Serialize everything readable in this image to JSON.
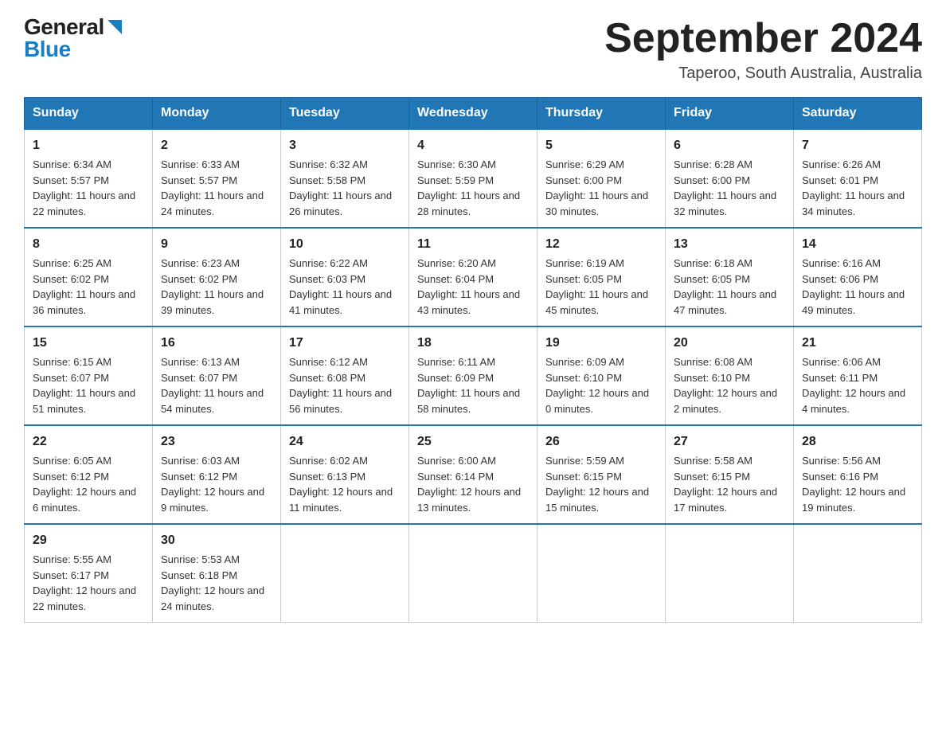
{
  "logo": {
    "general": "General",
    "blue": "Blue"
  },
  "header": {
    "month_year": "September 2024",
    "location": "Taperoo, South Australia, Australia"
  },
  "days_of_week": [
    "Sunday",
    "Monday",
    "Tuesday",
    "Wednesday",
    "Thursday",
    "Friday",
    "Saturday"
  ],
  "weeks": [
    [
      {
        "day": "1",
        "sunrise": "6:34 AM",
        "sunset": "5:57 PM",
        "daylight": "11 hours and 22 minutes."
      },
      {
        "day": "2",
        "sunrise": "6:33 AM",
        "sunset": "5:57 PM",
        "daylight": "11 hours and 24 minutes."
      },
      {
        "day": "3",
        "sunrise": "6:32 AM",
        "sunset": "5:58 PM",
        "daylight": "11 hours and 26 minutes."
      },
      {
        "day": "4",
        "sunrise": "6:30 AM",
        "sunset": "5:59 PM",
        "daylight": "11 hours and 28 minutes."
      },
      {
        "day": "5",
        "sunrise": "6:29 AM",
        "sunset": "6:00 PM",
        "daylight": "11 hours and 30 minutes."
      },
      {
        "day": "6",
        "sunrise": "6:28 AM",
        "sunset": "6:00 PM",
        "daylight": "11 hours and 32 minutes."
      },
      {
        "day": "7",
        "sunrise": "6:26 AM",
        "sunset": "6:01 PM",
        "daylight": "11 hours and 34 minutes."
      }
    ],
    [
      {
        "day": "8",
        "sunrise": "6:25 AM",
        "sunset": "6:02 PM",
        "daylight": "11 hours and 36 minutes."
      },
      {
        "day": "9",
        "sunrise": "6:23 AM",
        "sunset": "6:02 PM",
        "daylight": "11 hours and 39 minutes."
      },
      {
        "day": "10",
        "sunrise": "6:22 AM",
        "sunset": "6:03 PM",
        "daylight": "11 hours and 41 minutes."
      },
      {
        "day": "11",
        "sunrise": "6:20 AM",
        "sunset": "6:04 PM",
        "daylight": "11 hours and 43 minutes."
      },
      {
        "day": "12",
        "sunrise": "6:19 AM",
        "sunset": "6:05 PM",
        "daylight": "11 hours and 45 minutes."
      },
      {
        "day": "13",
        "sunrise": "6:18 AM",
        "sunset": "6:05 PM",
        "daylight": "11 hours and 47 minutes."
      },
      {
        "day": "14",
        "sunrise": "6:16 AM",
        "sunset": "6:06 PM",
        "daylight": "11 hours and 49 minutes."
      }
    ],
    [
      {
        "day": "15",
        "sunrise": "6:15 AM",
        "sunset": "6:07 PM",
        "daylight": "11 hours and 51 minutes."
      },
      {
        "day": "16",
        "sunrise": "6:13 AM",
        "sunset": "6:07 PM",
        "daylight": "11 hours and 54 minutes."
      },
      {
        "day": "17",
        "sunrise": "6:12 AM",
        "sunset": "6:08 PM",
        "daylight": "11 hours and 56 minutes."
      },
      {
        "day": "18",
        "sunrise": "6:11 AM",
        "sunset": "6:09 PM",
        "daylight": "11 hours and 58 minutes."
      },
      {
        "day": "19",
        "sunrise": "6:09 AM",
        "sunset": "6:10 PM",
        "daylight": "12 hours and 0 minutes."
      },
      {
        "day": "20",
        "sunrise": "6:08 AM",
        "sunset": "6:10 PM",
        "daylight": "12 hours and 2 minutes."
      },
      {
        "day": "21",
        "sunrise": "6:06 AM",
        "sunset": "6:11 PM",
        "daylight": "12 hours and 4 minutes."
      }
    ],
    [
      {
        "day": "22",
        "sunrise": "6:05 AM",
        "sunset": "6:12 PM",
        "daylight": "12 hours and 6 minutes."
      },
      {
        "day": "23",
        "sunrise": "6:03 AM",
        "sunset": "6:12 PM",
        "daylight": "12 hours and 9 minutes."
      },
      {
        "day": "24",
        "sunrise": "6:02 AM",
        "sunset": "6:13 PM",
        "daylight": "12 hours and 11 minutes."
      },
      {
        "day": "25",
        "sunrise": "6:00 AM",
        "sunset": "6:14 PM",
        "daylight": "12 hours and 13 minutes."
      },
      {
        "day": "26",
        "sunrise": "5:59 AM",
        "sunset": "6:15 PM",
        "daylight": "12 hours and 15 minutes."
      },
      {
        "day": "27",
        "sunrise": "5:58 AM",
        "sunset": "6:15 PM",
        "daylight": "12 hours and 17 minutes."
      },
      {
        "day": "28",
        "sunrise": "5:56 AM",
        "sunset": "6:16 PM",
        "daylight": "12 hours and 19 minutes."
      }
    ],
    [
      {
        "day": "29",
        "sunrise": "5:55 AM",
        "sunset": "6:17 PM",
        "daylight": "12 hours and 22 minutes."
      },
      {
        "day": "30",
        "sunrise": "5:53 AM",
        "sunset": "6:18 PM",
        "daylight": "12 hours and 24 minutes."
      },
      null,
      null,
      null,
      null,
      null
    ]
  ]
}
